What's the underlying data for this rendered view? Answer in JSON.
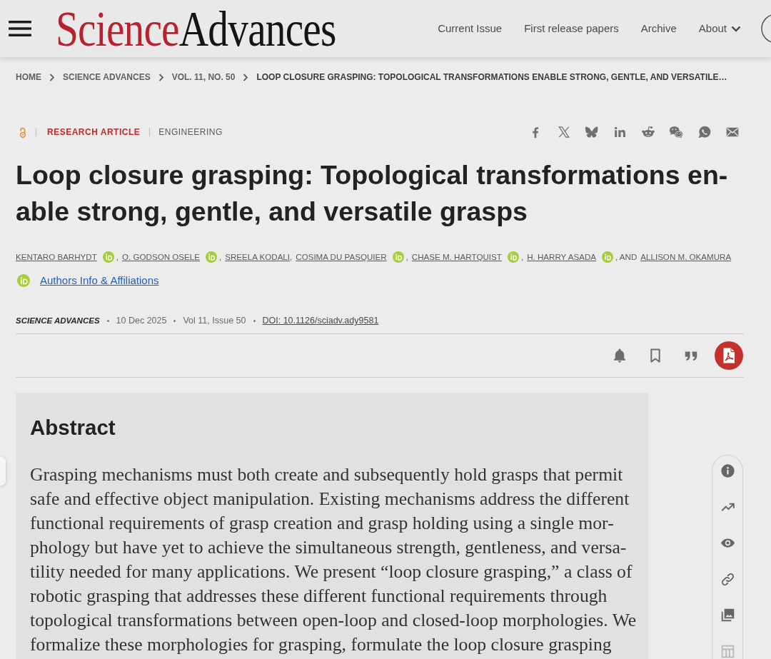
{
  "header": {
    "logo": [
      "Science",
      "Advances"
    ],
    "nav": [
      {
        "label": "Current Issue",
        "has_menu": false
      },
      {
        "label": "First release papers",
        "has_menu": false
      },
      {
        "label": "Archive",
        "has_menu": false
      },
      {
        "label": "About",
        "has_menu": true
      }
    ]
  },
  "breadcrumbs": [
    {
      "label": "HOME",
      "current": false
    },
    {
      "label": "SCIENCE ADVANCES",
      "current": false
    },
    {
      "label": "VOL. 11, NO. 50",
      "current": false
    },
    {
      "label": "LOOP CLOSURE GRASPING: TOPOLOGICAL TRANSFORMATIONS ENABLE STRONG, GENTLE, AND VERSATILE…",
      "current": true
    }
  ],
  "article": {
    "article_type": "RESEARCH ARTICLE",
    "subject": "ENGINEERING",
    "title": "Loop closure grasping: Topological transformations en-able strong, gentle, and versatile grasps",
    "authors": [
      {
        "name": "KENTARO BARHYDT",
        "orcid": true,
        "separator": ","
      },
      {
        "name": "O. GODSON OSELE",
        "orcid": true,
        "separator": ","
      },
      {
        "name": "SREELA KODALI",
        "orcid": false,
        "separator": ","
      },
      {
        "name": "COSIMA DU PASQUIER",
        "orcid": true,
        "separator": ","
      },
      {
        "name": "CHASE M. HARTQUIST",
        "orcid": true,
        "separator": ","
      },
      {
        "name": "H. HARRY ASADA",
        "orcid": true,
        "separator": ", AND"
      },
      {
        "name": "ALLISON M. OKAMURA",
        "orcid": false
      }
    ],
    "authors_info_link": "Authors Info & Affiliations",
    "journal": "SCIENCE ADVANCES",
    "date": "10 Dec 2025",
    "issue": "Vol 11, Issue 50",
    "doi": "DOI: 10.1126/sciadv.ady9581"
  },
  "abstract": {
    "heading": "Abstract",
    "text": "Grasping mechanisms must both create and subsequently hold grasps that permit safe and effective object manipulation. Existing mechanisms address the different functional requirements of grasp creation and grasp holding using a single mor-phology but have yet to achieve the simultaneous strength, gentleness, and versa-tility needed for many applications. We present “loop closure grasping,” a class of robotic grasping that addresses these different functional requirements through topological transformations between open-loop and closed-loop morphologies. We formalize these morphologies for grasping, formulate the loop closure grasping"
  },
  "side_toolbar": [
    {
      "kind": "info",
      "disabled": false
    },
    {
      "kind": "metrics",
      "disabled": false
    },
    {
      "kind": "view",
      "disabled": false
    },
    {
      "kind": "link",
      "disabled": false
    },
    {
      "kind": "figures",
      "disabled": false
    },
    {
      "kind": "tables",
      "disabled": true
    }
  ]
}
